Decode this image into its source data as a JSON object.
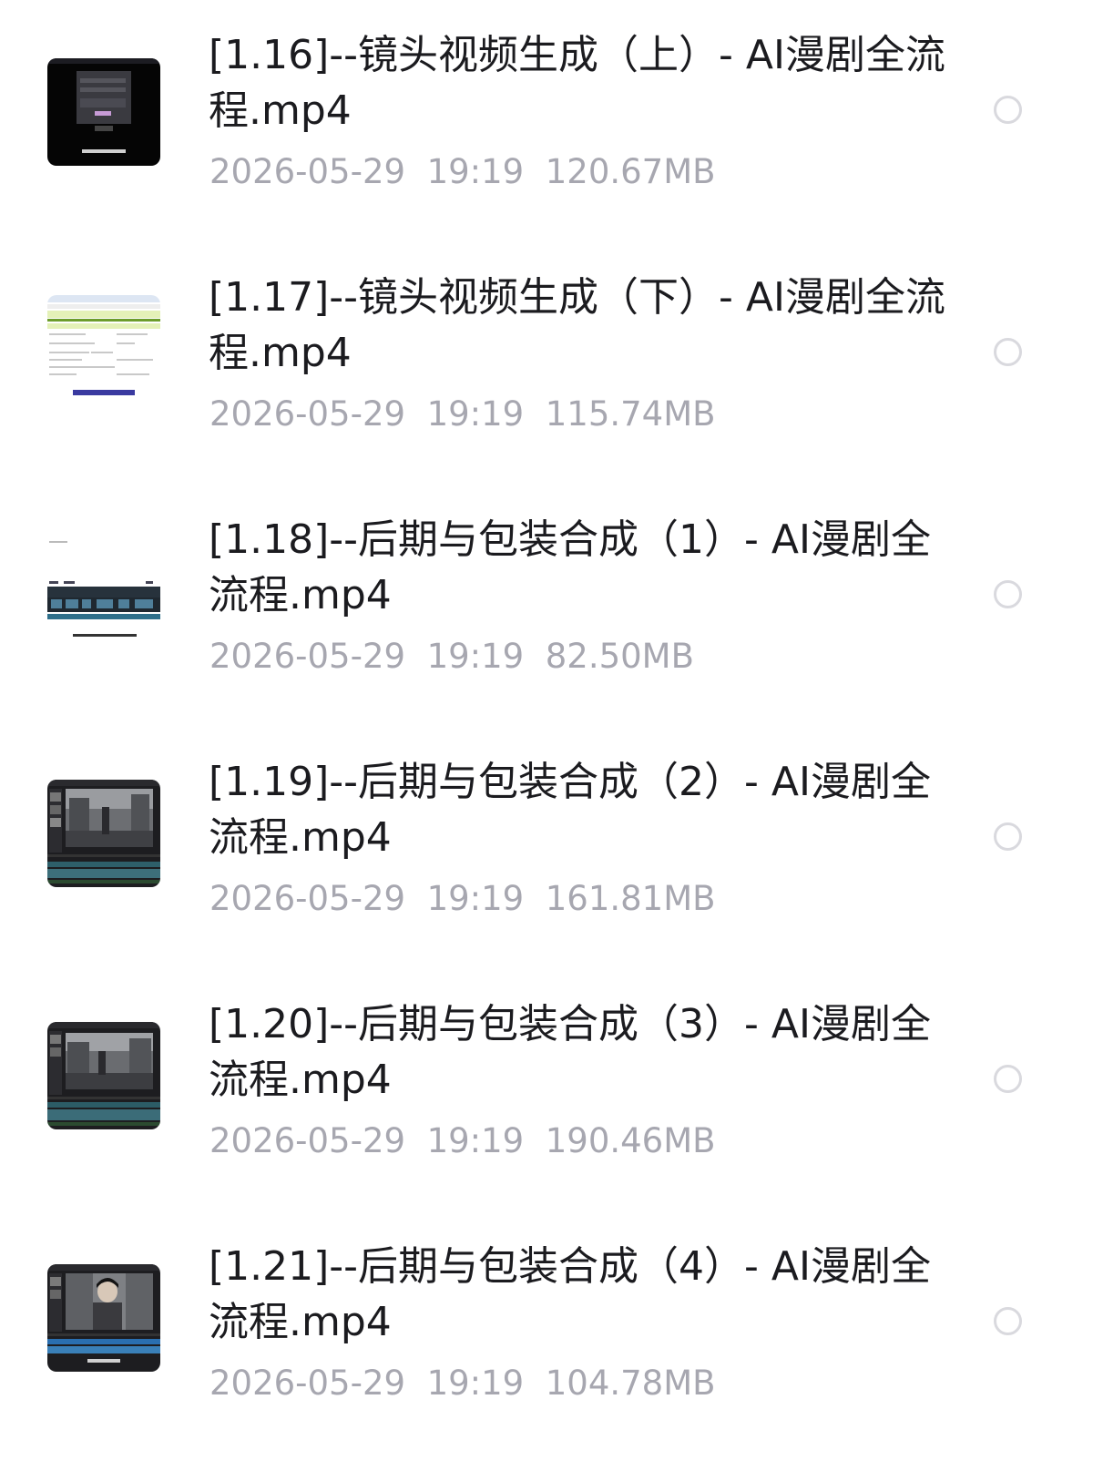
{
  "files": [
    {
      "title": "[1.16]--镜头视频生成（上）- AI漫剧全流程.mp4",
      "date": "2026-05-29",
      "time": "19:19",
      "size": "120.67MB",
      "thumbnail": "dark-dialog-screenshot"
    },
    {
      "title": "[1.17]--镜头视频生成（下）- AI漫剧全流程.mp4",
      "date": "2026-05-29",
      "time": "19:19",
      "size": "115.74MB",
      "thumbnail": "spreadsheet-screenshot"
    },
    {
      "title": "[1.18]--后期与包装合成（1）- AI漫剧全流程.mp4",
      "date": "2026-05-29",
      "time": "19:19",
      "size": "82.50MB",
      "thumbnail": "timeline-strip-screenshot"
    },
    {
      "title": "[1.19]--后期与包装合成（2）- AI漫剧全流程.mp4",
      "date": "2026-05-29",
      "time": "19:19",
      "size": "161.81MB",
      "thumbnail": "video-editor-street-scene"
    },
    {
      "title": "[1.20]--后期与包装合成（3）- AI漫剧全流程.mp4",
      "date": "2026-05-29",
      "time": "19:19",
      "size": "190.46MB",
      "thumbnail": "video-editor-street-scene"
    },
    {
      "title": "[1.21]--后期与包装合成（4）- AI漫剧全流程.mp4",
      "date": "2026-05-29",
      "time": "19:19",
      "size": "104.78MB",
      "thumbnail": "video-editor-character-closeup"
    }
  ]
}
